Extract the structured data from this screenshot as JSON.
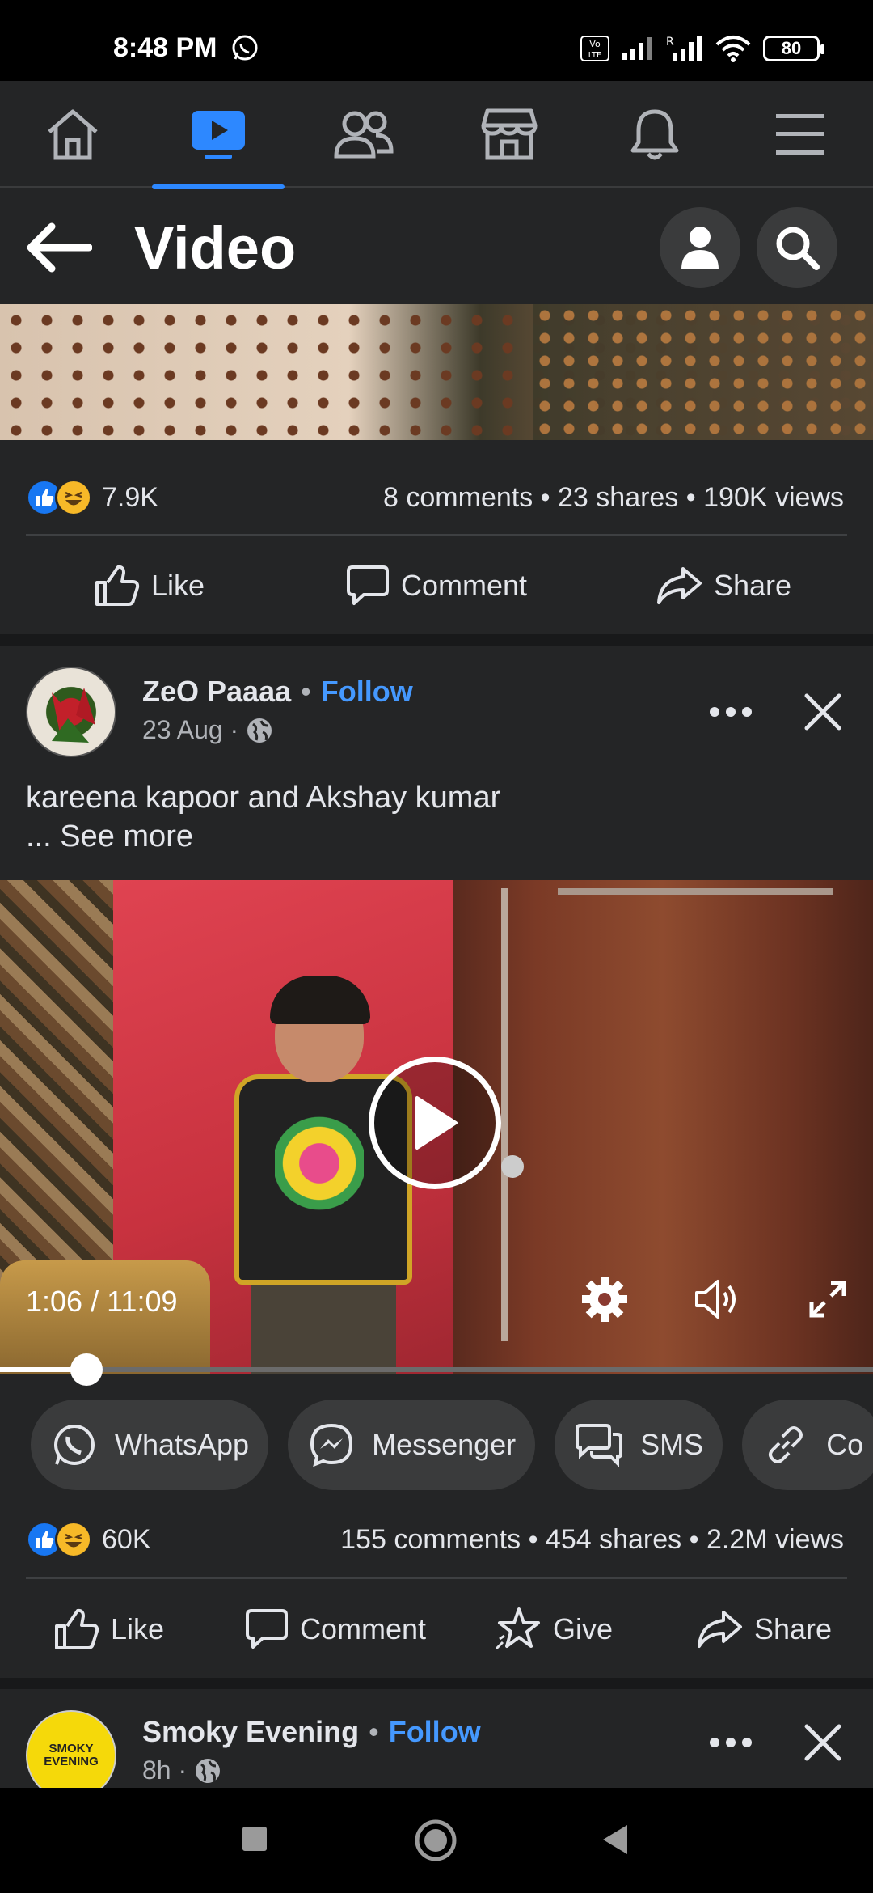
{
  "status_bar": {
    "time": "8:48 PM",
    "battery": "80",
    "icons": [
      "whatsapp-icon",
      "volte-icon",
      "signal-icon",
      "signal-roaming-icon",
      "wifi-icon",
      "battery-icon"
    ]
  },
  "top_nav": {
    "items": [
      {
        "name": "home",
        "icon": "home-icon",
        "active": false
      },
      {
        "name": "video",
        "icon": "video-icon",
        "active": true
      },
      {
        "name": "friends",
        "icon": "friends-icon",
        "active": false
      },
      {
        "name": "marketplace",
        "icon": "marketplace-icon",
        "active": false
      },
      {
        "name": "notifications",
        "icon": "bell-icon",
        "active": false
      },
      {
        "name": "menu",
        "icon": "hamburger-icon",
        "active": false
      }
    ],
    "accent_color": "#2d88ff"
  },
  "header": {
    "title": "Video"
  },
  "post1": {
    "reaction_count": "7.9K",
    "meta": "8 comments • 23 shares • 190K views",
    "actions": {
      "like": "Like",
      "comment": "Comment",
      "share": "Share"
    }
  },
  "post2": {
    "author": "ZeO Paaaa",
    "separator": "•",
    "follow": "Follow",
    "date": "23 Aug ·",
    "caption": "kareena kapoor and Akshay kumar",
    "see_more": "... See more",
    "video": {
      "time": "1:06 / 11:09",
      "progress": 0.099
    },
    "share_chips": [
      {
        "label": "WhatsApp",
        "icon": "whatsapp-icon"
      },
      {
        "label": "Messenger",
        "icon": "messenger-icon"
      },
      {
        "label": "SMS",
        "icon": "sms-icon"
      },
      {
        "label": "Co",
        "icon": "link-icon"
      }
    ],
    "reaction_count": "60K",
    "meta": "155 comments • 454 shares • 2.2M views",
    "actions": {
      "like": "Like",
      "comment": "Comment",
      "give": "Give",
      "share": "Share"
    }
  },
  "post3": {
    "author": "Smoky Evening",
    "separator": "•",
    "follow": "Follow",
    "date": "8h ·",
    "avatar_text_1": "SMOKY",
    "avatar_text_2": "EVENING"
  }
}
